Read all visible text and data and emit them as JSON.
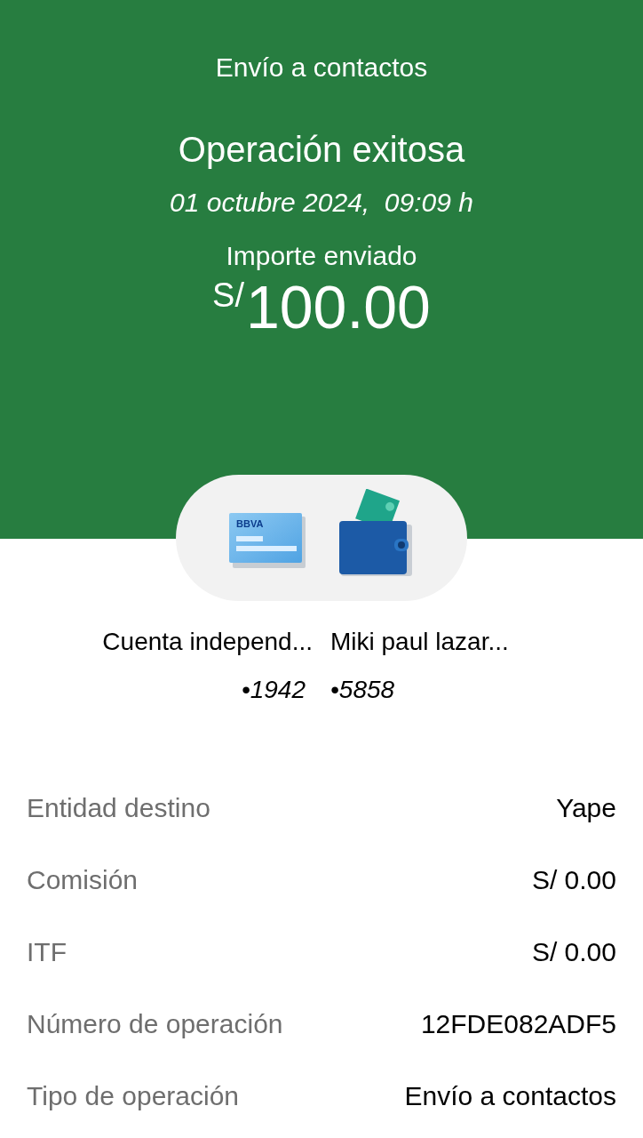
{
  "header": {
    "title": "Envío a contactos",
    "status": "Operación exitosa",
    "datetime": "01 octubre 2024,  09:09 h",
    "amount_label": "Importe enviado",
    "currency": "S/",
    "amount": "100.00"
  },
  "transfer": {
    "card_logo": "BBVA",
    "from": {
      "name": "Cuenta independ...",
      "account": "•1942"
    },
    "to": {
      "name": "Miki paul lazar...",
      "account": "•5858"
    }
  },
  "details": [
    {
      "label": "Entidad destino",
      "value": "Yape"
    },
    {
      "label": "Comisión",
      "value": "S/ 0.00"
    },
    {
      "label": "ITF",
      "value": "S/ 0.00"
    },
    {
      "label": "Número de operación",
      "value": "12FDE082ADF5"
    },
    {
      "label": "Tipo de operación",
      "value": "Envío a contactos"
    }
  ]
}
